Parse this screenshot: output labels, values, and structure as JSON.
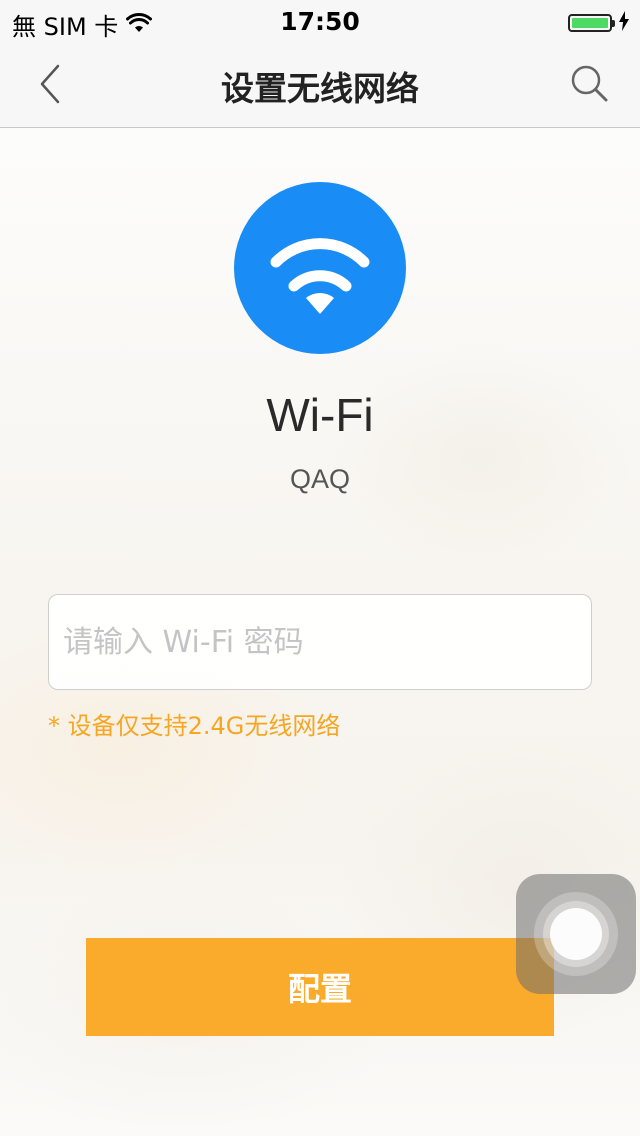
{
  "status_bar": {
    "carrier": "無 SIM 卡",
    "time": "17:50",
    "battery_color": "#4cd964",
    "wifi_icon": "wifi-signal-icon",
    "charging_icon": "bolt-icon"
  },
  "nav": {
    "title": "设置无线网络",
    "back_icon": "chevron-left-icon",
    "search_icon": "search-icon"
  },
  "network": {
    "icon": "wifi-icon",
    "icon_color": "#1a8cf6",
    "title": "Wi-Fi",
    "ssid": "QAQ"
  },
  "form": {
    "password_value": "",
    "password_placeholder": "请输入 Wi-Fi 密码",
    "hint": "* 设备仅支持2.4G无线网络",
    "hint_color": "#f5a623"
  },
  "actions": {
    "config_label": "配置",
    "config_color": "#fbab2b"
  }
}
